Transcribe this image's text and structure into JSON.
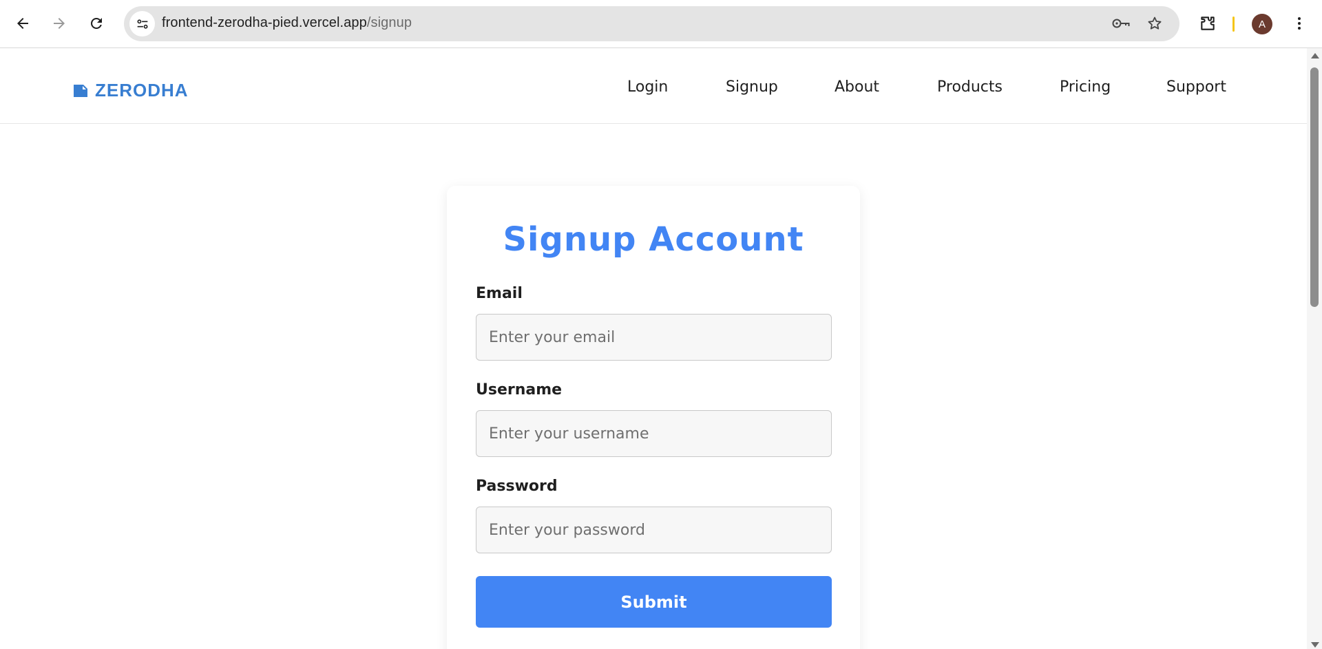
{
  "browser": {
    "url_host": "frontend-zerodha-pied.vercel.app",
    "url_path": "/signup",
    "profile_initial": "A",
    "icons": [
      "back-arrow-icon",
      "forward-arrow-icon",
      "reload-icon",
      "site-settings-icon",
      "password-key-icon",
      "bookmark-star-icon",
      "extensions-puzzle-icon",
      "more-menu-icon"
    ]
  },
  "site_nav": {
    "logo_text": "ZERODHA",
    "links": [
      {
        "label": "Login"
      },
      {
        "label": "Signup"
      },
      {
        "label": "About"
      },
      {
        "label": "Products"
      },
      {
        "label": "Pricing"
      },
      {
        "label": "Support"
      }
    ]
  },
  "signup": {
    "title": "Signup Account",
    "email": {
      "label": "Email",
      "placeholder": "Enter your email",
      "value": ""
    },
    "username": {
      "label": "Username",
      "placeholder": "Enter your username",
      "value": ""
    },
    "password": {
      "label": "Password",
      "placeholder": "Enter your password",
      "value": ""
    },
    "submit_label": "Submit"
  },
  "colors": {
    "brand_blue": "#387ed1",
    "accent_blue": "#4285f4",
    "input_bg": "#f7f7f7"
  }
}
